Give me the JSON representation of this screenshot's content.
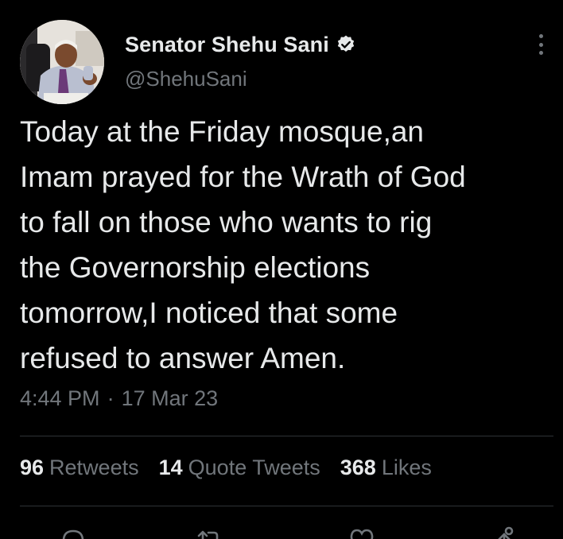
{
  "author": {
    "display_name": "Senator Shehu Sani",
    "handle": "@ShehuSani",
    "verified_icon": "verified-badge-icon"
  },
  "tweet": {
    "text": "Today at the Friday mosque,an\nImam prayed for the Wrath of God\nto fall on those who wants to rig\nthe Governorship elections\ntomorrow,I noticed that some\nrefused to answer Amen.",
    "time": "4:44 PM",
    "separator": "·",
    "date": "17 Mar 23"
  },
  "stats": {
    "retweets": {
      "count": "96",
      "label": "Retweets"
    },
    "quote_tweets": {
      "count": "14",
      "label": "Quote Tweets"
    },
    "likes": {
      "count": "368",
      "label": "Likes"
    }
  },
  "actions": [
    "reply-icon",
    "retweet-icon",
    "like-icon",
    "share-icon"
  ],
  "colors": {
    "background": "#000000",
    "primary_text": "#e7e9ea",
    "secondary_text": "#71767b",
    "divider": "#2f3336"
  }
}
